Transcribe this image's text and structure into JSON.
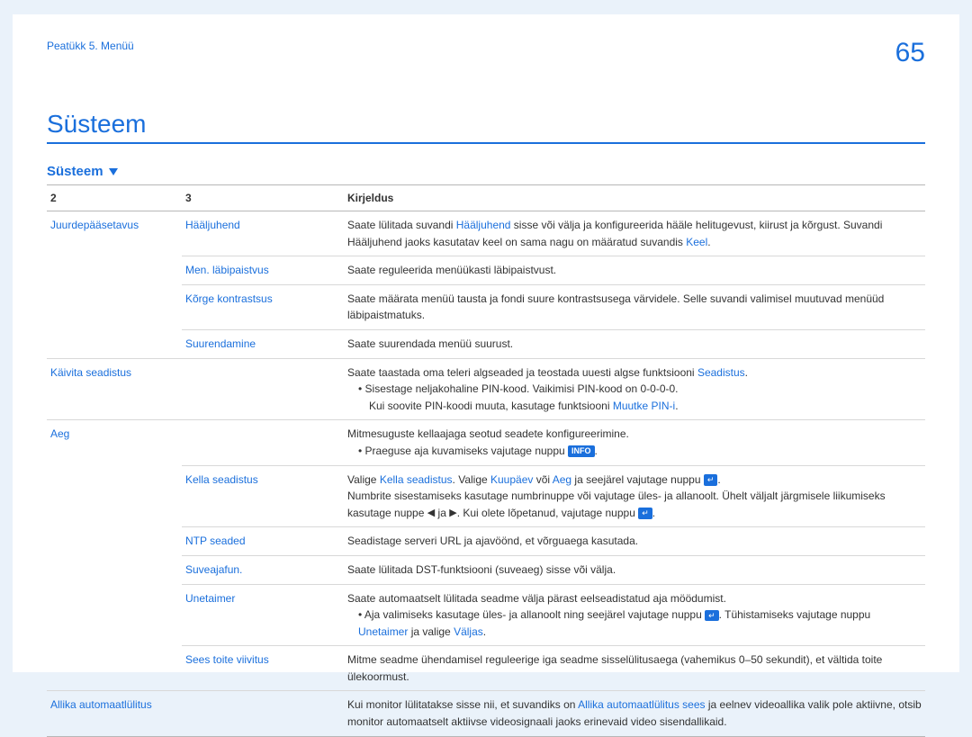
{
  "header": {
    "chapter": "Peatükk 5. Menüü",
    "pageNumber": "65"
  },
  "title": "Süsteem",
  "subtitle": "Süsteem",
  "columns": {
    "c2": "2",
    "c3": "3",
    "desc": "Kirjeldus"
  },
  "rows": {
    "r1": {
      "c2": "Juurdepääsetavus",
      "c3": "Hääljuhend",
      "d_a": "Saate lülitada suvandi ",
      "d_link1": "Hääljuhend",
      "d_b": " sisse või välja ja konfigureerida hääle helitugevust, kiirust ja kõrgust. Suvandi Hääljuhend jaoks kasutatav keel on sama nagu on määratud suvandis ",
      "d_link2": "Keel",
      "d_c": "."
    },
    "r2": {
      "c3": "Men. läbipaistvus",
      "d": "Saate reguleerida menüükasti läbipaistvust."
    },
    "r3": {
      "c3": "Kõrge kontrastsus",
      "d": "Saate määrata menüü tausta ja fondi suure kontrastsusega värvidele. Selle suvandi valimisel muutuvad menüüd läbipaistmatuks."
    },
    "r4": {
      "c3": "Suurendamine",
      "d": "Saate suurendada menüü suurust."
    },
    "r5": {
      "c2": "Käivita seadistus",
      "d_a": "Saate taastada oma teleri algseaded ja teostada uuesti algse funktsiooni ",
      "d_link1": "Seadistus",
      "d_b": ".",
      "b1": "Sisestage neljakohaline PIN-kood. Vaikimisi PIN-kood on 0-0-0-0.",
      "b2_a": "Kui soovite PIN-koodi muuta, kasutage funktsiooni ",
      "b2_link": "Muutke PIN-i",
      "b2_b": "."
    },
    "r6": {
      "c2": "Aeg",
      "d": "Mitmesuguste kellaajaga seotud seadete konfigureerimine.",
      "b1_a": "Praeguse aja kuvamiseks vajutage nuppu ",
      "info": "INFO",
      "b1_b": "."
    },
    "r7": {
      "c3": "Kella seadistus",
      "d_a": "Valige ",
      "d_link1": "Kella seadistus",
      "d_b": ". Valige ",
      "d_link2": "Kuupäev",
      "d_c": " või ",
      "d_link3": "Aeg",
      "d_d": " ja seejärel vajutage nuppu ",
      "enter": "↵",
      "d_e": ".",
      "d2_a": "Numbrite sisestamiseks kasutage numbrinuppe või vajutage üles- ja allanoolt. Ühelt väljalt järgmisele liikumiseks kasutage nuppe ",
      "arrL": "◀",
      "d2_b": " ja ",
      "arrR": "▶",
      "d2_c": ". Kui olete lõpetanud, vajutage nuppu ",
      "d2_d": "."
    },
    "r8": {
      "c3": "NTP seaded",
      "d": "Seadistage serveri URL ja ajavöönd, et võrguaega kasutada."
    },
    "r9": {
      "c3": "Suveajafun.",
      "d": "Saate lülitada DST-funktsiooni (suveaeg) sisse või välja."
    },
    "r10": {
      "c3": "Unetaimer",
      "d": "Saate automaatselt lülitada seadme välja pärast eelseadistatud aja möödumist.",
      "b1_a": "Aja valimiseks kasutage üles- ja allanoolt ning seejärel vajutage nuppu ",
      "enter": "↵",
      "b1_b": ". Tühistamiseks vajutage nuppu ",
      "b1_link1": "Unetaimer",
      "b1_c": " ja valige ",
      "b1_link2": "Väljas",
      "b1_d": "."
    },
    "r11": {
      "c3": "Sees toite viivitus",
      "d": "Mitme seadme ühendamisel reguleerige iga seadme sisselülitusaega (vahemikus 0–50 sekundit), et vältida toite ülekoormust."
    },
    "r12": {
      "c2": "Allika automaatlülitus",
      "d_a": "Kui monitor lülitatakse sisse nii, et suvandiks on ",
      "d_link1": "Allika automaatlülitus sees",
      "d_b": " ja eelnev videoallika valik pole aktiivne, otsib monitor automaatselt aktiivse videosignaali jaoks erinevaid video sisendallikaid."
    }
  }
}
